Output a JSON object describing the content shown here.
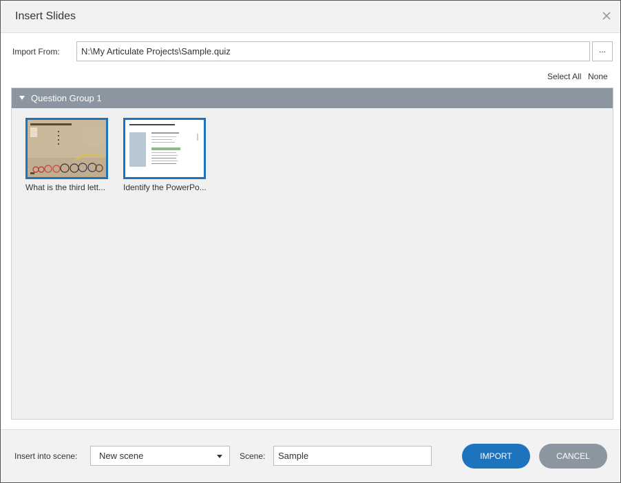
{
  "dialog": {
    "title": "Insert Slides",
    "close_icon": "close-icon"
  },
  "import": {
    "label": "Import From:",
    "path": "N:\\My Articulate Projects\\Sample.quiz",
    "browse_label": "..."
  },
  "selection": {
    "select_all": "Select All",
    "none": "None"
  },
  "group": {
    "title": "Question Group 1",
    "slides": [
      {
        "caption": "What is the third lett..."
      },
      {
        "caption": "Identify the PowerPo..."
      }
    ]
  },
  "footer": {
    "insert_label": "Insert into scene:",
    "insert_value": "New scene",
    "scene_label": "Scene:",
    "scene_value": "Sample",
    "import_button": "IMPORT",
    "cancel_button": "CANCEL"
  },
  "colors": {
    "accent": "#1e73be",
    "header": "#8c96a0"
  }
}
